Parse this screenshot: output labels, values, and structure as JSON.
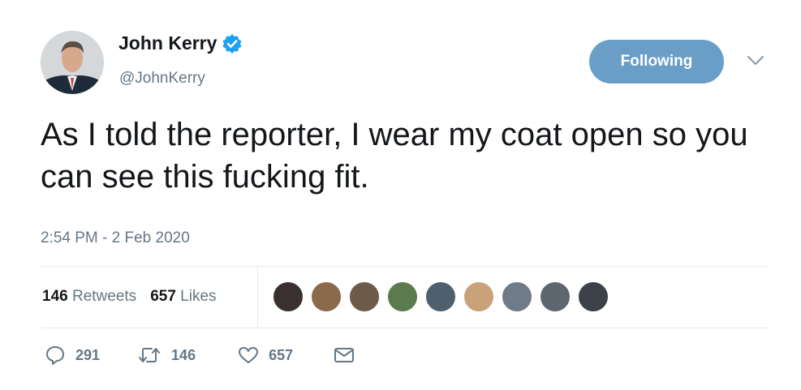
{
  "tweet": {
    "display_name": "John Kerry",
    "handle": "@JohnKerry",
    "text": "As I told the reporter, I wear my coat open so you can see this fucking fit.",
    "timestamp": "2:54 PM - 2 Feb 2020",
    "follow_label": "Following"
  },
  "stats": {
    "retweets_count": "146",
    "retweets_label": "Retweets",
    "likes_count": "657",
    "likes_label": "Likes"
  },
  "liker_avatar_colors": [
    "#3a3030",
    "#8a6a4a",
    "#6e5a48",
    "#5b7a4e",
    "#4e5f6e",
    "#c9a27a",
    "#6f7b86",
    "#5e6670",
    "#3c4148"
  ],
  "actions": {
    "reply_count": "291",
    "retweet_count": "146",
    "like_count": "657"
  },
  "colors": {
    "follow_button": "#6b9ec7",
    "verified": "#1da1f2",
    "secondary_text": "#657786"
  }
}
